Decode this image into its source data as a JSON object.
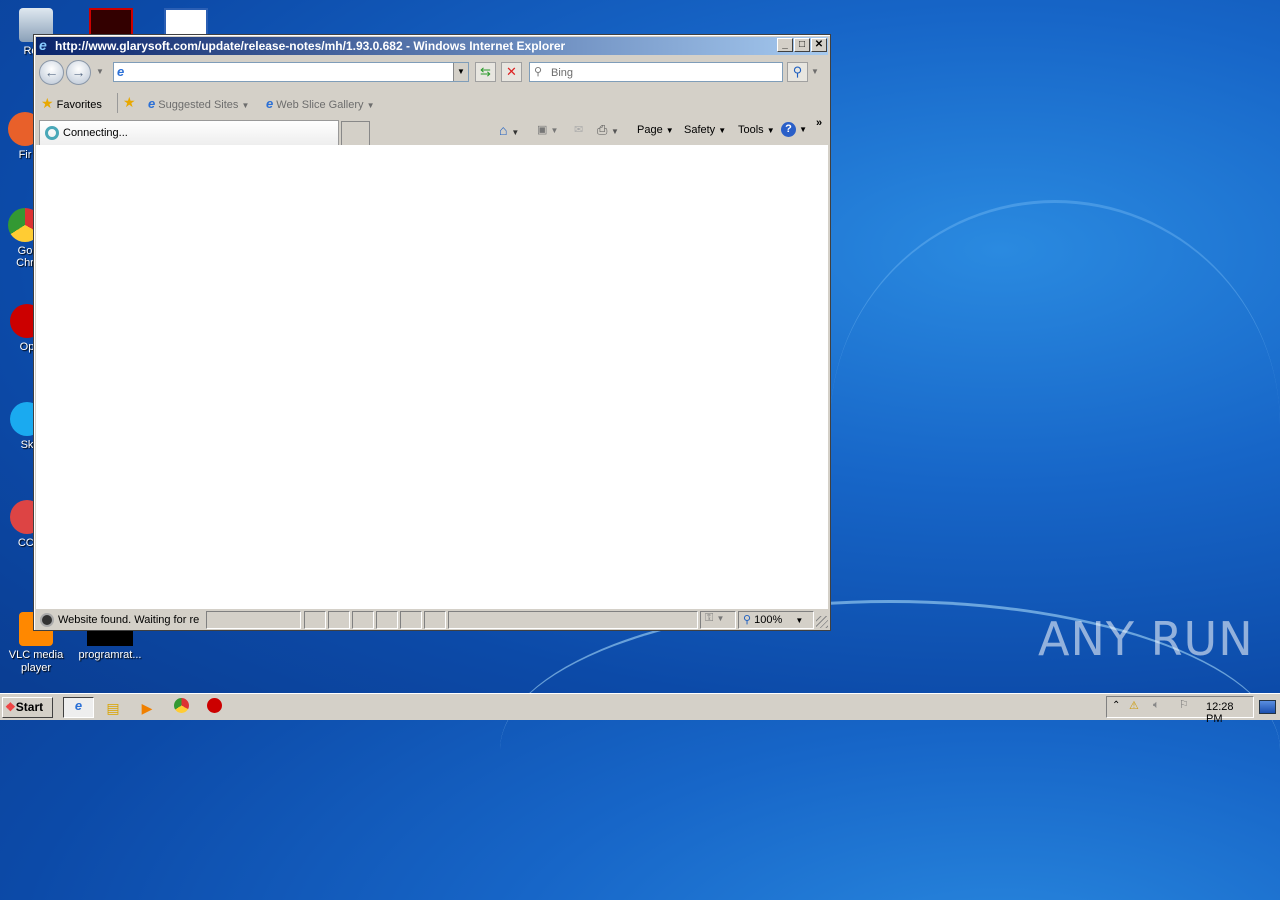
{
  "desktop": {
    "icons": [
      {
        "label": "Recy",
        "name": "recycle-bin"
      },
      {
        "label": "Fir",
        "name": "firefox"
      },
      {
        "label": "Go\nChr",
        "name": "google-chrome"
      },
      {
        "label": "Op",
        "name": "opera"
      },
      {
        "label": "Sk",
        "name": "skype"
      },
      {
        "label": "CCl",
        "name": "ccleaner"
      },
      {
        "label": "VLC media player",
        "name": "vlc"
      },
      {
        "label": "programrat...",
        "name": "program-file"
      }
    ],
    "watermark": "ANY RUN"
  },
  "browser": {
    "title": "http://www.glarysoft.com/update/release-notes/mh/1.93.0.682 - Windows Internet Explorer",
    "address_value": "",
    "search_placeholder": "Bing",
    "favorites_label": "Favorites",
    "fav_links": [
      "Suggested Sites",
      "Web Slice Gallery"
    ],
    "tab_label": "Connecting...",
    "commands": [
      "Page",
      "Safety",
      "Tools"
    ],
    "status_text": "Website found. Waiting for re",
    "zoom": "100%"
  },
  "taskbar": {
    "start": "Start",
    "clock": "12:28 PM"
  }
}
